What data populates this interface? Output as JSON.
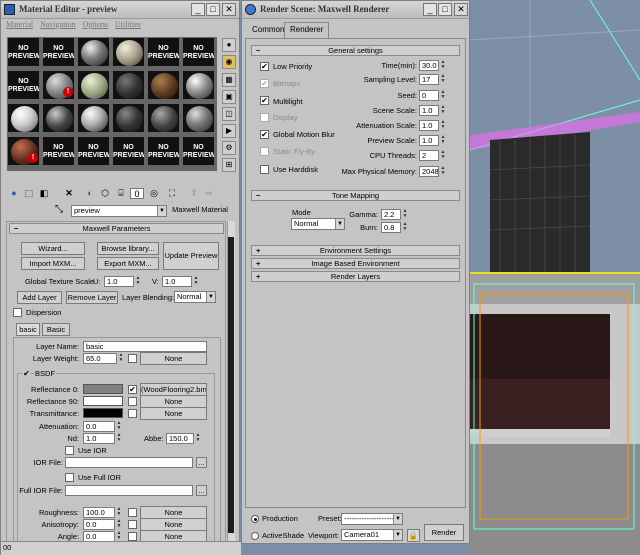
{
  "material_editor": {
    "title": "Material Editor - preview",
    "menu": [
      "Material",
      "Navigation",
      "Options",
      "Utilities"
    ],
    "swatches": [
      {
        "label": "NO\nPREVIEW",
        "kind": "text"
      },
      {
        "label": "NO\nPREVIEW",
        "kind": "text"
      },
      {
        "label": "",
        "kind": "ball",
        "color": "radial-gradient(circle at 35% 30%,#eee,#777 45%,#222)"
      },
      {
        "label": "",
        "kind": "ball",
        "color": "radial-gradient(circle at 35% 30%,#f0ece0,#a89f8a 50%,#3a362e)"
      },
      {
        "label": "NO\nPREVIEW",
        "kind": "text"
      },
      {
        "label": "NO\nPREVIEW",
        "kind": "text"
      },
      {
        "label": "NO\nPREVIEW",
        "kind": "text"
      },
      {
        "label": "",
        "kind": "ball",
        "color": "radial-gradient(circle at 35% 30%,#ddd,#888 45%,#333)",
        "warn": "!"
      },
      {
        "label": "",
        "kind": "ball",
        "color": "radial-gradient(circle at 35% 30%,#e8eed8,#9aa883 50%,#3c4432)"
      },
      {
        "label": "",
        "kind": "ball",
        "color": "radial-gradient(circle at 35% 30%,#777,#333 50%,#0d0d0d)"
      },
      {
        "label": "",
        "kind": "ball",
        "color": "radial-gradient(circle at 35% 30%,#a88050,#5e3d20 50%,#1e1208)"
      },
      {
        "label": "",
        "kind": "ball",
        "color": "radial-gradient(circle at 35% 30%,#fff,#999 40%,#222)"
      },
      {
        "label": "",
        "kind": "ball",
        "color": "radial-gradient(circle at 35% 30%,#fff,#ccc 45%,#555)"
      },
      {
        "label": "",
        "kind": "ball",
        "color": "radial-gradient(circle at 35% 30%,#ccc,#444 50%,#111)"
      },
      {
        "label": "",
        "kind": "ball",
        "color": "radial-gradient(circle at 35% 30%,#fff,#aaa 45%,#222)"
      },
      {
        "label": "",
        "kind": "ball",
        "color": "radial-gradient(circle at 35% 30%,#888,#333 50%,#111)"
      },
      {
        "label": "",
        "kind": "ball",
        "color": "radial-gradient(circle at 35% 30%,#aaa,#444 50%,#111)"
      },
      {
        "label": "",
        "kind": "ball",
        "color": "radial-gradient(circle at 35% 30%,#ddd,#777 45%,#222)"
      },
      {
        "label": "",
        "kind": "ball",
        "color": "radial-gradient(circle at 35% 30%,#c07050,#6a3020 50%,#200c06)",
        "warn": "!"
      },
      {
        "label": "NO\nPREVIEW",
        "kind": "text"
      },
      {
        "label": "NO\nPREVIEW",
        "kind": "text"
      },
      {
        "label": "NO\nPREVIEW",
        "kind": "text"
      },
      {
        "label": "NO\nPREVIEW",
        "kind": "text"
      },
      {
        "label": "NO\nPREVIEW",
        "kind": "text"
      }
    ],
    "material_name": "preview",
    "material_type": "Maxwell Material",
    "rollout_title": "Maxwell Parameters",
    "wizard": "Wizard...",
    "browse": "Browse library...",
    "update_preview": "Update Preview",
    "import_mxm": "Import MXM...",
    "export_mxm": "Export MXM...",
    "global_texture_scale": "Global Texture Scale",
    "u_label": "U:",
    "u_value": "1.0",
    "v_label": "V:",
    "v_value": "1.0",
    "add_layer": "Add Layer",
    "remove_layer": "Remove Layer",
    "layer_blending_label": "Layer Blending:",
    "layer_blending_value": "Normal",
    "dispersion": "Dispersion",
    "layer_tabs": [
      "basic",
      "Basic"
    ],
    "layer_name_label": "Layer Name:",
    "layer_name": "basic",
    "layer_weight_label": "Layer Weight:",
    "layer_weight": "65.0",
    "none": "None",
    "bsdf": "BSDF",
    "reflectance0_label": "Reflectance 0:",
    "reflectance0_map": "(WoodFlooring2.bmp)",
    "reflectance0_color": "#808080",
    "reflectance90_label": "Reflectance 90:",
    "reflectance90_color": "#ffffff",
    "transmittance_label": "Transmittance:",
    "transmittance_color": "#000000",
    "attenuation_label": "Attenuation:",
    "attenuation": "0.0",
    "nd_label": "Nd:",
    "nd": "1.0",
    "abbe_label": "Abbe:",
    "abbe": "150.0",
    "use_ior": "Use IOR",
    "ior_file_label": "IOR File:",
    "use_full_ior": "Use Full IOR",
    "full_ior_file_label": "Full IOR File:",
    "roughness_label": "Roughness:",
    "roughness": "100.0",
    "anisotropy_label": "Anisotropy:",
    "anisotropy": "0.0",
    "angle_label": "Angle:",
    "angle": "0.0",
    "browse_dots": "...",
    "status": "00"
  },
  "render_scene": {
    "title": "Render Scene: Maxwell Renderer",
    "tabs": [
      "Common",
      "Renderer"
    ],
    "general_settings": "General settings",
    "low_priority": "Low Priority",
    "bitmaps": "Bitmaps",
    "multilight": "Multilight",
    "display": "Display",
    "global_motion_blur": "Global Motion Blur",
    "static_flyby": "Static Fly-By",
    "use_harddisk": "Use Harddisk",
    "time_label": "Time(min):",
    "time": "30.0",
    "sampling_label": "Sampling Level:",
    "sampling": "17",
    "seed_label": "Seed:",
    "seed": "0",
    "scene_scale_label": "Scene Scale:",
    "scene_scale": "1.0",
    "attenuation_scale_label": "Attenuation Scale:",
    "attenuation_scale": "1.0",
    "preview_scale_label": "Preview Scale:",
    "preview_scale": "1.0",
    "cpu_threads_label": "CPU Threads:",
    "cpu_threads": "2",
    "max_mem_label": "Max Physical Memory:",
    "max_mem": "2048",
    "tone_mapping": "Tone Mapping",
    "mode_label": "Mode",
    "mode": "Normal",
    "gamma_label": "Gamma:",
    "gamma": "2.2",
    "burn_label": "Burn:",
    "burn": "0.8",
    "environment_settings": "Environment Settings",
    "ibe": "Image Based Environment",
    "render_layers": "Render Layers",
    "production": "Production",
    "activeshade": "ActiveShade",
    "preset_label": "Preset:",
    "preset": "--------------------",
    "viewport_label": "Viewport:",
    "viewport": "Camera01",
    "render": "Render"
  },
  "colors": {
    "viewport_top": "#7d8fa6",
    "viewport_border": "#e8e020",
    "wireframe": "#ff66ff",
    "light_line": "#66ffdd"
  }
}
